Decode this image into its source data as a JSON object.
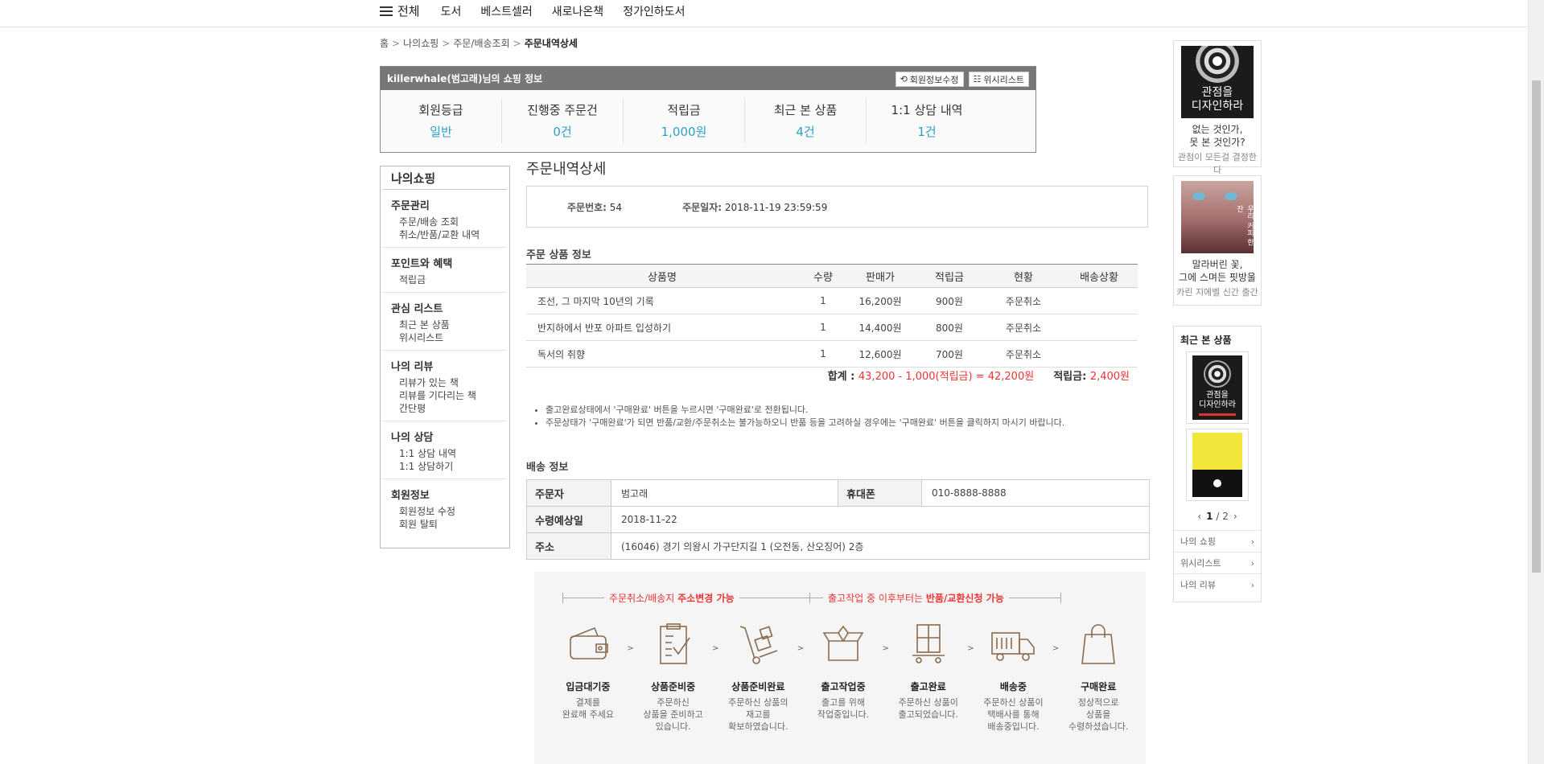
{
  "nav": {
    "all": "전체",
    "items": [
      "도서",
      "베스트셀러",
      "새로나온책",
      "정가인하도서"
    ]
  },
  "breadcrumb": {
    "home": "홈",
    "my": "나의쇼핑",
    "order": "주문/배송조회",
    "current": "주문내역상세"
  },
  "member": {
    "title": "killerwhale(범고래)님의 쇼핑 정보",
    "edit_btn": "회원정보수정",
    "wish_btn": "위시리스트",
    "stats": [
      {
        "label": "회원등급",
        "value": "일반"
      },
      {
        "label": "진행중 주문건",
        "value": "0건"
      },
      {
        "label": "적립금",
        "value": "1,000원"
      },
      {
        "label": "최근 본 상품",
        "value": "4건"
      },
      {
        "label": "1:1 상담 내역",
        "value": "1건"
      }
    ]
  },
  "side": {
    "title": "나의쇼핑",
    "groups": [
      {
        "title": "주문관리",
        "items": [
          "주문/배송 조회",
          "취소/반품/교환 내역"
        ]
      },
      {
        "title": "포인트와 혜택",
        "items": [
          "적립금"
        ]
      },
      {
        "title": "관심 리스트",
        "items": [
          "최근 본 상품",
          "위시리스트"
        ]
      },
      {
        "title": "나의 리뷰",
        "items": [
          "리뷰가 있는 책",
          "리뷰를 기다리는 책",
          "간단평"
        ]
      },
      {
        "title": "나의 상담",
        "items": [
          "1:1 상담 내역",
          "1:1 상담하기"
        ]
      },
      {
        "title": "회원정보",
        "items": [
          "회원정보 수정",
          "회원 탈퇴"
        ]
      }
    ]
  },
  "main": {
    "title": "주문내역상세",
    "order_no_label": "주문번호:",
    "order_no": "54",
    "order_date_label": "주문일자:",
    "order_date": "2018-11-19 23:59:59",
    "items_title": "주문 상품 정보",
    "columns": [
      "상품명",
      "수량",
      "판매가",
      "적립금",
      "현황",
      "배송상황"
    ],
    "items": [
      {
        "name": "조선, 그 마지막 10년의 기록",
        "qty": "1",
        "price": "16,200원",
        "point": "900원",
        "status": "주문취소",
        "ship": ""
      },
      {
        "name": "반지하에서 반포 아파트 입성하기",
        "qty": "1",
        "price": "14,400원",
        "point": "800원",
        "status": "주문취소",
        "ship": ""
      },
      {
        "name": "독서의 취향",
        "qty": "1",
        "price": "12,600원",
        "point": "700원",
        "status": "주문취소",
        "ship": ""
      }
    ],
    "total_label": "합계 :",
    "total_value": "43,200 - 1,000(적립금) = 42,200원",
    "point_label": "적립금:",
    "point_value": "2,400원",
    "notes": [
      "출고완료상태에서 '구매완료' 버튼을 누르시면 '구매완료'로 전환됩니다.",
      "주문상태가 '구매완료'가 되면 반품/교환/주문취소는 불가능하오니 반품 등을 고려하실 경우에는 '구매완료' 버튼을 클릭하지 마시기 바랍니다."
    ],
    "ship_title": "배송 정보",
    "ship": {
      "orderer_label": "주문자",
      "orderer": "범고래",
      "phone_label": "휴대폰",
      "phone": "010-8888-8888",
      "expected_label": "수령예상일",
      "expected": "2018-11-22",
      "address_label": "주소",
      "address": "(16046) 경기 의왕시 가구단지길 1 (오전동, 산오징어) 2층"
    }
  },
  "process": {
    "left_pre": "주문취소/배송지 ",
    "left_bold": "주소변경 가능",
    "right_pre": "출고작업 중 이후부터는 ",
    "right_bold": "반품/교환신청 가능",
    "steps": [
      {
        "name": "입금대기중",
        "desc": [
          "결제를",
          "완료해 주세요"
        ],
        "icon": "wallet-icon"
      },
      {
        "name": "상품준비중",
        "desc": [
          "주문하신",
          "상품을 준비하고",
          "있습니다."
        ],
        "icon": "clipboard-icon"
      },
      {
        "name": "상품준비완료",
        "desc": [
          "주문하신 상품의",
          "재고를",
          "확보하였습니다."
        ],
        "icon": "handcart-icon"
      },
      {
        "name": "출고작업중",
        "desc": [
          "출고를 위해",
          "작업중입니다."
        ],
        "icon": "open-box-icon"
      },
      {
        "name": "출고완료",
        "desc": [
          "주문하신 상품이",
          "출고되었습니다."
        ],
        "icon": "box-on-cart-icon"
      },
      {
        "name": "배송중",
        "desc": [
          "주문하신 상품이",
          "택배사를 통해",
          "배송중입니다."
        ],
        "icon": "truck-icon"
      },
      {
        "name": "구매완료",
        "desc": [
          "정상적으로",
          "상품을",
          "수령하셨습니다."
        ],
        "icon": "shopping-bag-icon"
      }
    ]
  },
  "right": {
    "book1": {
      "cover_lines": [
        "관점을",
        "디자인하라"
      ],
      "caption": [
        "없는 것인가,",
        "못 본 것인가?"
      ],
      "sub": "관점이 모든걸 결정한다"
    },
    "book2": {
      "cover_text": "우리 커피 한 잔",
      "caption": [
        "말라버린 꽃,",
        "그에 스며든 핏방울"
      ],
      "sub": "카린 지에벨 신간 출간"
    },
    "recent_title": "최근 본 상품",
    "page_current": "1",
    "page_total": "/ 2",
    "links": [
      "나의 쇼핑",
      "위시리스트",
      "나의 리뷰"
    ]
  }
}
